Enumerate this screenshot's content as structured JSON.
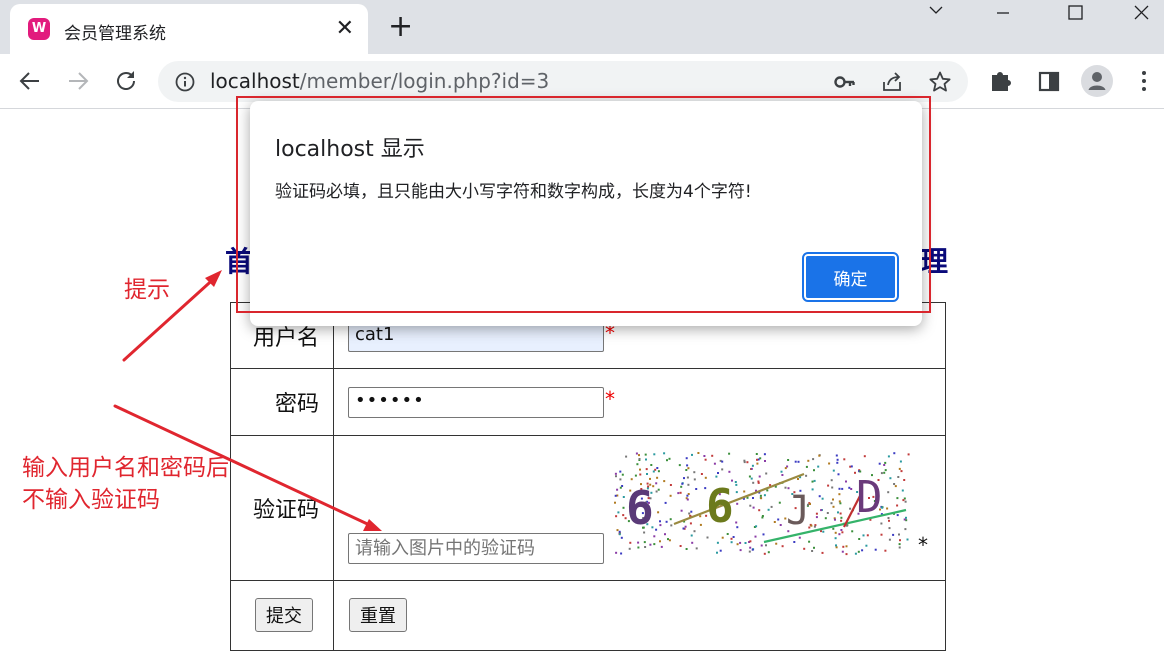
{
  "browser": {
    "tab_title": "会员管理系统",
    "tab_favicon": "W",
    "tab_close": "✕",
    "new_tab": "+",
    "url_host": "localhost",
    "url_path": "/member/login.php?id=3"
  },
  "page": {
    "heading_left": "首",
    "heading_right": "理",
    "username_label": "用户名",
    "username_value": "cat1",
    "password_label": "密码",
    "password_value": "••••••",
    "captcha_label": "验证码",
    "captcha_placeholder": "请输入图片中的验证码",
    "captcha_chars": [
      "6",
      "6",
      "J",
      "D"
    ],
    "required_mark": "*",
    "captcha_required_mark": "*",
    "submit_label": "提交",
    "reset_label": "重置"
  },
  "dialog": {
    "title": "localhost 显示",
    "message": "验证码必填，且只能由大小写字符和数字构成，长度为4个字符!",
    "ok_label": "确定"
  },
  "annotations": {
    "hint": "提示",
    "note_line1": "输入用户名和密码后",
    "note_line2": "不输入验证码"
  },
  "colors": {
    "annotation": "#e0262f",
    "dialog_button": "#1a73e8",
    "heading": "#0a0a7a",
    "favicon": "#e21b7d"
  },
  "icons": [
    "favicon-icon",
    "close-icon",
    "plus-icon",
    "minimize-icon",
    "maximize-icon",
    "window-close-icon",
    "back-icon",
    "forward-icon",
    "reload-icon",
    "info-icon",
    "key-icon",
    "share-icon",
    "star-icon",
    "extensions-icon",
    "sidepanel-icon",
    "profile-icon",
    "menu-icon"
  ]
}
